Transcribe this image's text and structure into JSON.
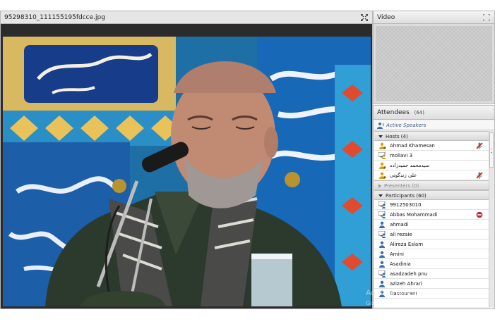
{
  "share_pod": {
    "title": "95298310_111155195fdcce.jpg"
  },
  "video_pod": {
    "title": "Video"
  },
  "attendees": {
    "title": "Attendees",
    "count": "(64)",
    "active_speakers": "Active Speakers",
    "hosts": {
      "label": "Hosts (4)",
      "items": [
        {
          "name": "Ahmad Khamesan",
          "icon": "host-user-icon",
          "status": "no-microphone-icon"
        },
        {
          "name": "mollavi 3",
          "icon": "host-monitor-user-icon",
          "status": ""
        },
        {
          "name": "سیدمحمد حمیدزاده",
          "icon": "host-user-icon",
          "status": ""
        },
        {
          "name": "علی زندگونی",
          "icon": "host-user-icon",
          "status": "no-microphone-icon"
        }
      ]
    },
    "presenters": {
      "label": "Presenters (0)"
    },
    "participants": {
      "label": "Participants (60)",
      "items": [
        {
          "name": "9912503010",
          "icon": "monitor-user-icon",
          "status": ""
        },
        {
          "name": "Abbas Mohammadi",
          "icon": "monitor-user-icon",
          "status": "remove-icon"
        },
        {
          "name": "ahmadi",
          "icon": "user-icon",
          "status": ""
        },
        {
          "name": "ali rezaie",
          "icon": "monitor-user-icon",
          "status": ""
        },
        {
          "name": "Alireza Eslam",
          "icon": "user-icon",
          "status": ""
        },
        {
          "name": "Amini",
          "icon": "user-icon",
          "status": ""
        },
        {
          "name": "Asadinia",
          "icon": "user-icon",
          "status": ""
        },
        {
          "name": "asadzadeh pnu",
          "icon": "monitor-user-icon",
          "status": ""
        },
        {
          "name": "azizeh Ahrari",
          "icon": "user-icon",
          "status": ""
        },
        {
          "name": "Dastourani",
          "icon": "user-icon",
          "status": ""
        }
      ]
    }
  },
  "watermark": {
    "line1": "Activate Windows",
    "line2": "Go to Settings to activate Windows."
  },
  "colors": {
    "host_icon": "#d4a21a",
    "user_icon": "#3a6fb5",
    "no_mic": "#c0282d",
    "remove": "#c0282d"
  }
}
